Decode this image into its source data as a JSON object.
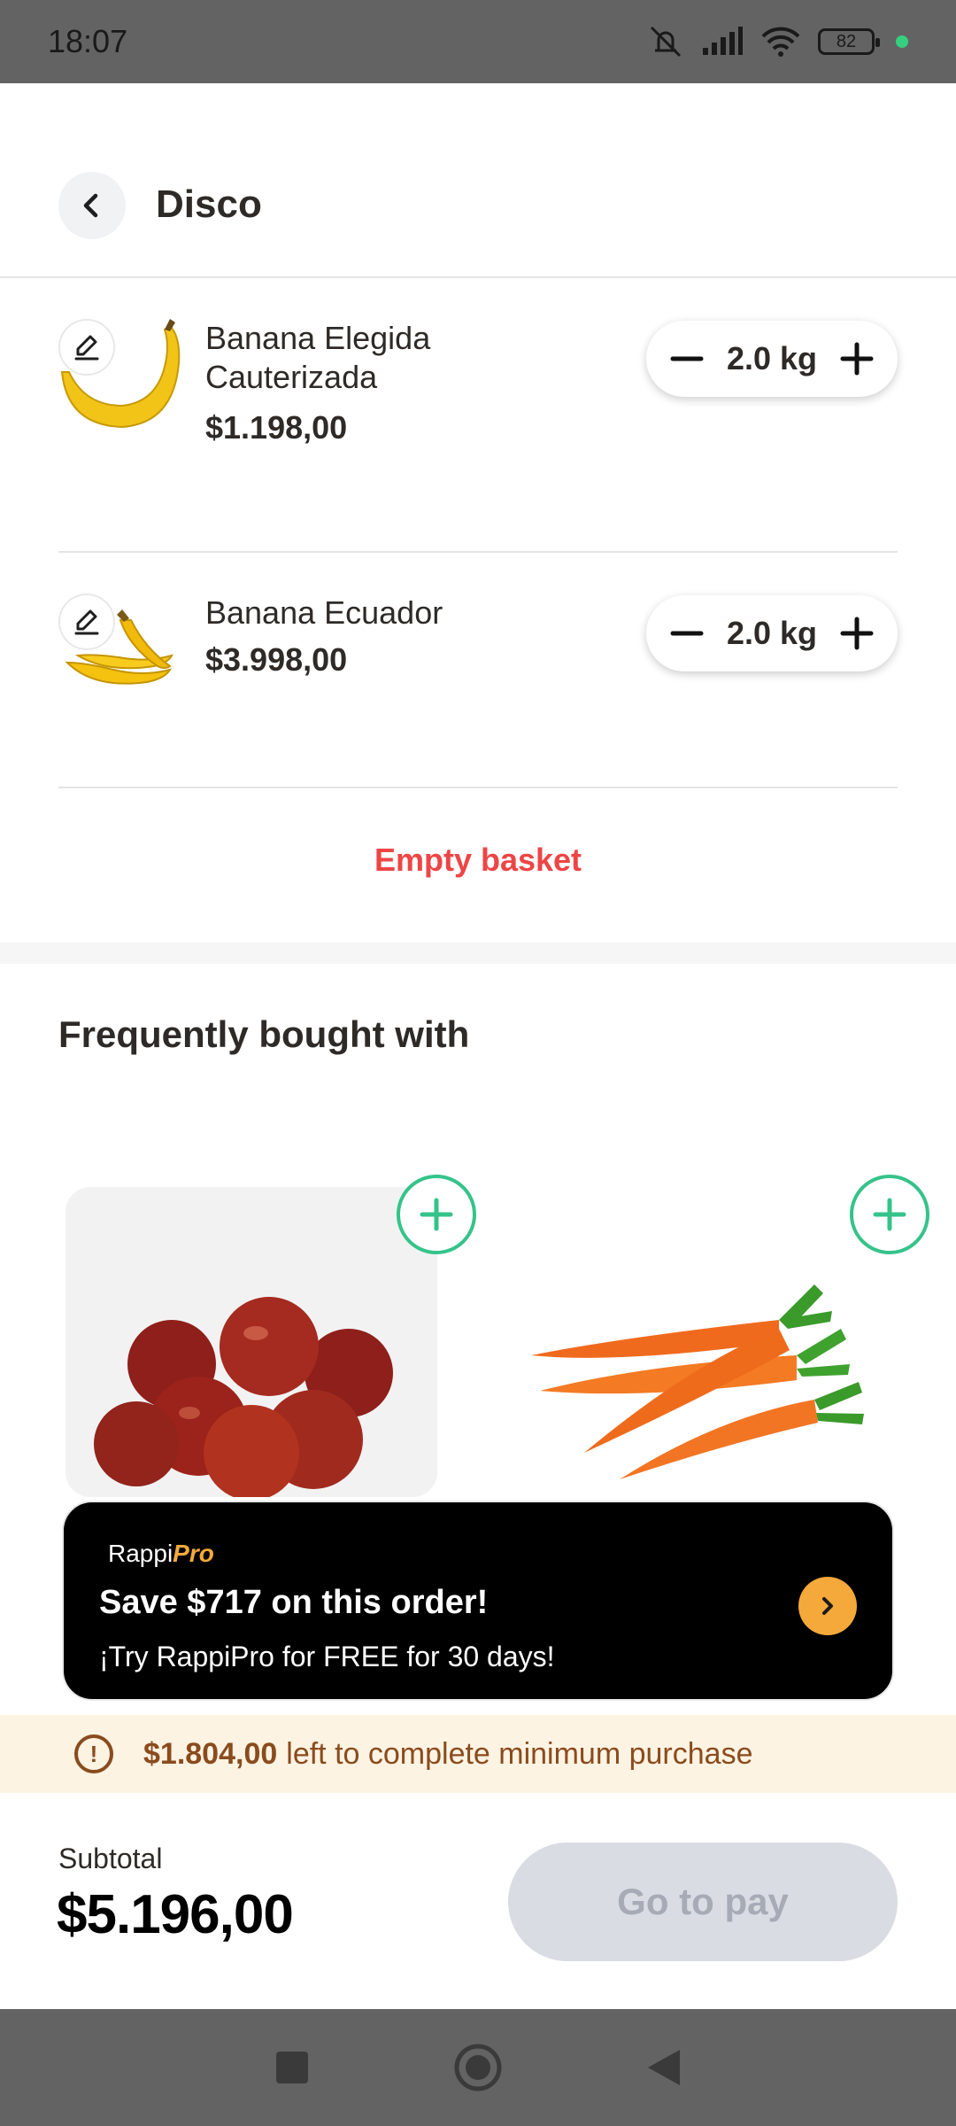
{
  "status_bar": {
    "time": "18:07",
    "battery": "82"
  },
  "header": {
    "title": "Disco"
  },
  "cart": {
    "items": [
      {
        "name": "Banana Elegida Cauterizada",
        "price": "$1.198,00",
        "quantity": "2.0 kg"
      },
      {
        "name": "Banana Ecuador",
        "price": "$3.998,00",
        "quantity": "2.0 kg"
      }
    ],
    "empty_label": "Empty basket"
  },
  "frequently": {
    "title": "Frequently bought with",
    "products": [
      {
        "image": "apples"
      },
      {
        "image": "carrots"
      }
    ]
  },
  "pro_banner": {
    "logo_text": "Rappi",
    "logo_pro": "Pro",
    "title": "Save $717 on this order!",
    "subtitle": "¡Try RappiPro for FREE for 30 days!"
  },
  "minimum": {
    "amount": "$1.804,00",
    "text": "left to complete minimum purchase"
  },
  "footer": {
    "subtotal_label": "Subtotal",
    "subtotal_value": "$5.196,00",
    "pay_label": "Go to pay"
  },
  "colors": {
    "accent_red": "#ee4545",
    "add_green": "#35c38a",
    "pro_orange": "#f4a93a"
  }
}
